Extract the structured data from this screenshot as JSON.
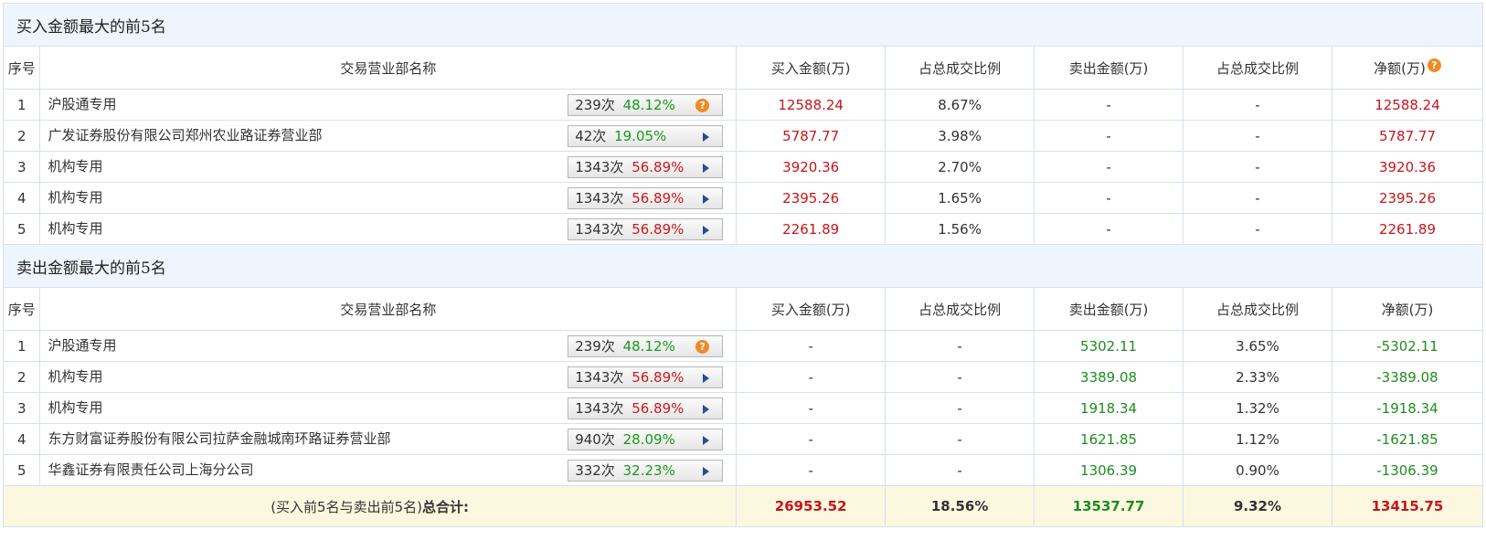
{
  "buy_section": {
    "title": "买入金额最大的前5名",
    "headers": [
      "序号",
      "交易营业部名称",
      "买入金额(万)",
      "占总成交比例",
      "卖出金额(万)",
      "占总成交比例",
      "净额(万)"
    ],
    "rows": [
      {
        "idx": "1",
        "name": "沪股通专用",
        "count": "239次",
        "pct": "48.12%",
        "pct_color": "green",
        "icon": "question-icon",
        "buy": "12588.24",
        "buy_ratio": "8.67%",
        "sell": "-",
        "sell_ratio": "-",
        "net": "12588.24"
      },
      {
        "idx": "2",
        "name": "广发证券股份有限公司郑州农业路证券营业部",
        "count": "42次",
        "pct": "19.05%",
        "pct_color": "green",
        "icon": "arrow-right-icon",
        "buy": "5787.77",
        "buy_ratio": "3.98%",
        "sell": "-",
        "sell_ratio": "-",
        "net": "5787.77"
      },
      {
        "idx": "3",
        "name": "机构专用",
        "count": "1343次",
        "pct": "56.89%",
        "pct_color": "red",
        "icon": "arrow-right-icon",
        "buy": "3920.36",
        "buy_ratio": "2.70%",
        "sell": "-",
        "sell_ratio": "-",
        "net": "3920.36"
      },
      {
        "idx": "4",
        "name": "机构专用",
        "count": "1343次",
        "pct": "56.89%",
        "pct_color": "red",
        "icon": "arrow-right-icon",
        "buy": "2395.26",
        "buy_ratio": "1.65%",
        "sell": "-",
        "sell_ratio": "-",
        "net": "2395.26"
      },
      {
        "idx": "5",
        "name": "机构专用",
        "count": "1343次",
        "pct": "56.89%",
        "pct_color": "red",
        "icon": "arrow-right-icon",
        "buy": "2261.89",
        "buy_ratio": "1.56%",
        "sell": "-",
        "sell_ratio": "-",
        "net": "2261.89"
      }
    ]
  },
  "sell_section": {
    "title": "卖出金额最大的前5名",
    "headers": [
      "序号",
      "交易营业部名称",
      "买入金额(万)",
      "占总成交比例",
      "卖出金额(万)",
      "占总成交比例",
      "净额(万)"
    ],
    "rows": [
      {
        "idx": "1",
        "name": "沪股通专用",
        "count": "239次",
        "pct": "48.12%",
        "pct_color": "green",
        "icon": "question-icon",
        "buy": "-",
        "buy_ratio": "-",
        "sell": "5302.11",
        "sell_ratio": "3.65%",
        "net": "-5302.11"
      },
      {
        "idx": "2",
        "name": "机构专用",
        "count": "1343次",
        "pct": "56.89%",
        "pct_color": "red",
        "icon": "arrow-right-icon",
        "buy": "-",
        "buy_ratio": "-",
        "sell": "3389.08",
        "sell_ratio": "2.33%",
        "net": "-3389.08"
      },
      {
        "idx": "3",
        "name": "机构专用",
        "count": "1343次",
        "pct": "56.89%",
        "pct_color": "red",
        "icon": "arrow-right-icon",
        "buy": "-",
        "buy_ratio": "-",
        "sell": "1918.34",
        "sell_ratio": "1.32%",
        "net": "-1918.34"
      },
      {
        "idx": "4",
        "name": "东方财富证券股份有限公司拉萨金融城南环路证券营业部",
        "count": "940次",
        "pct": "28.09%",
        "pct_color": "green",
        "icon": "arrow-right-icon",
        "buy": "-",
        "buy_ratio": "-",
        "sell": "1621.85",
        "sell_ratio": "1.12%",
        "net": "-1621.85"
      },
      {
        "idx": "5",
        "name": "华鑫证券有限责任公司上海分公司",
        "count": "332次",
        "pct": "32.23%",
        "pct_color": "green",
        "icon": "arrow-right-icon",
        "buy": "-",
        "buy_ratio": "-",
        "sell": "1306.39",
        "sell_ratio": "0.90%",
        "net": "-1306.39"
      }
    ]
  },
  "total": {
    "label_prefix": "(买入前5名与卖出前5名)",
    "label_bold": "总合计:",
    "buy": "26953.52",
    "buy_ratio": "18.56%",
    "sell": "13537.77",
    "sell_ratio": "9.32%",
    "net": "13415.75"
  },
  "icons": {
    "question_glyph": "?"
  },
  "colors": {
    "up": "#c8141c",
    "down": "#1f8d1f",
    "header_bg": "#eef5fc",
    "total_bg": "#fcf8e0",
    "border": "#d6e1ec"
  }
}
